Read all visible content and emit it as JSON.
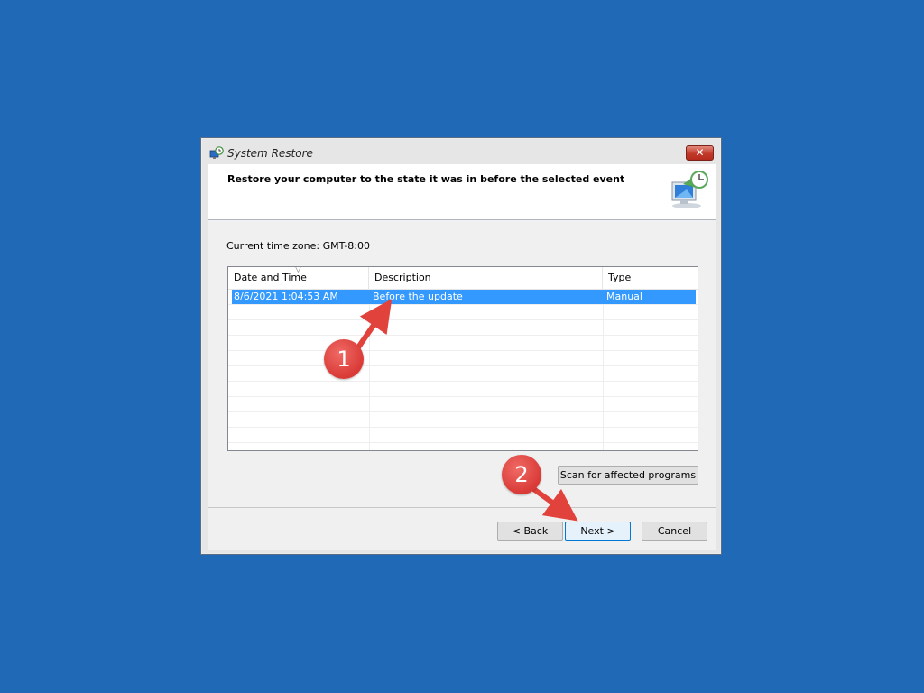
{
  "window": {
    "title": "System Restore",
    "close_label": "✕"
  },
  "header": {
    "title": "Restore your computer to the state it was in before the selected event"
  },
  "timezone_text": "Current time zone: GMT-8:00",
  "list": {
    "columns": [
      "Date and Time",
      "Description",
      "Type"
    ],
    "sort_indicator": "▽",
    "rows": [
      {
        "date": "8/6/2021 1:04:53 AM",
        "description": "Before the update",
        "type": "Manual",
        "selected": true
      }
    ]
  },
  "buttons": {
    "scan": "Scan for affected programs",
    "back": "< Back",
    "next": "Next >",
    "cancel": "Cancel"
  },
  "annotations": [
    {
      "label": "1"
    },
    {
      "label": "2"
    }
  ],
  "colors": {
    "desktop": "#1f69b6",
    "selection": "#3399ff",
    "annotation": "#e2423c"
  }
}
